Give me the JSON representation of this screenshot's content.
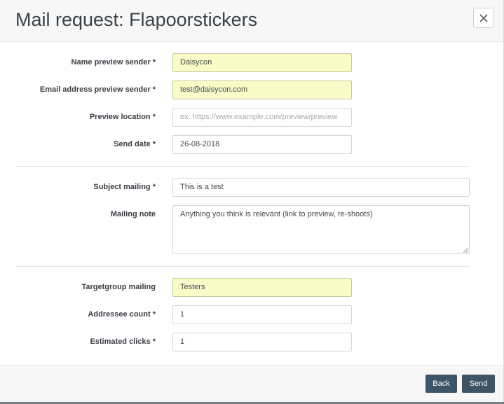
{
  "modal": {
    "title": "Mail request: Flapoorstickers",
    "close_icon": "close-icon"
  },
  "fields": {
    "name_preview_sender": {
      "label": "Name preview sender *",
      "value": "Daisycon"
    },
    "email_preview_sender": {
      "label": "Email address preview sender *",
      "value": "test@daisycon.com"
    },
    "preview_location": {
      "label": "Preview location *",
      "value": "",
      "placeholder": "ex. https://www.example.com/preview/preview"
    },
    "send_date": {
      "label": "Send date *",
      "value": "26-08-2018"
    },
    "subject_mailing": {
      "label": "Subject mailing *",
      "value": "This is a test"
    },
    "mailing_note": {
      "label": "Mailing note",
      "value": "Anything you think is relevant (link to preview, re-shoots)"
    },
    "targetgroup_mailing": {
      "label": "Targetgroup mailing",
      "value": "Testers"
    },
    "addressee_count": {
      "label": "Addressee count *",
      "value": "1"
    },
    "estimated_clicks": {
      "label": "Estimated clicks *",
      "value": "1"
    }
  },
  "footer": {
    "back_label": "Back",
    "send_label": "Send"
  },
  "colors": {
    "highlight_field": "#fafbc6",
    "button": "#3d5366",
    "header_bg": "#f7f7f7",
    "backdrop": "#6b6f73"
  }
}
